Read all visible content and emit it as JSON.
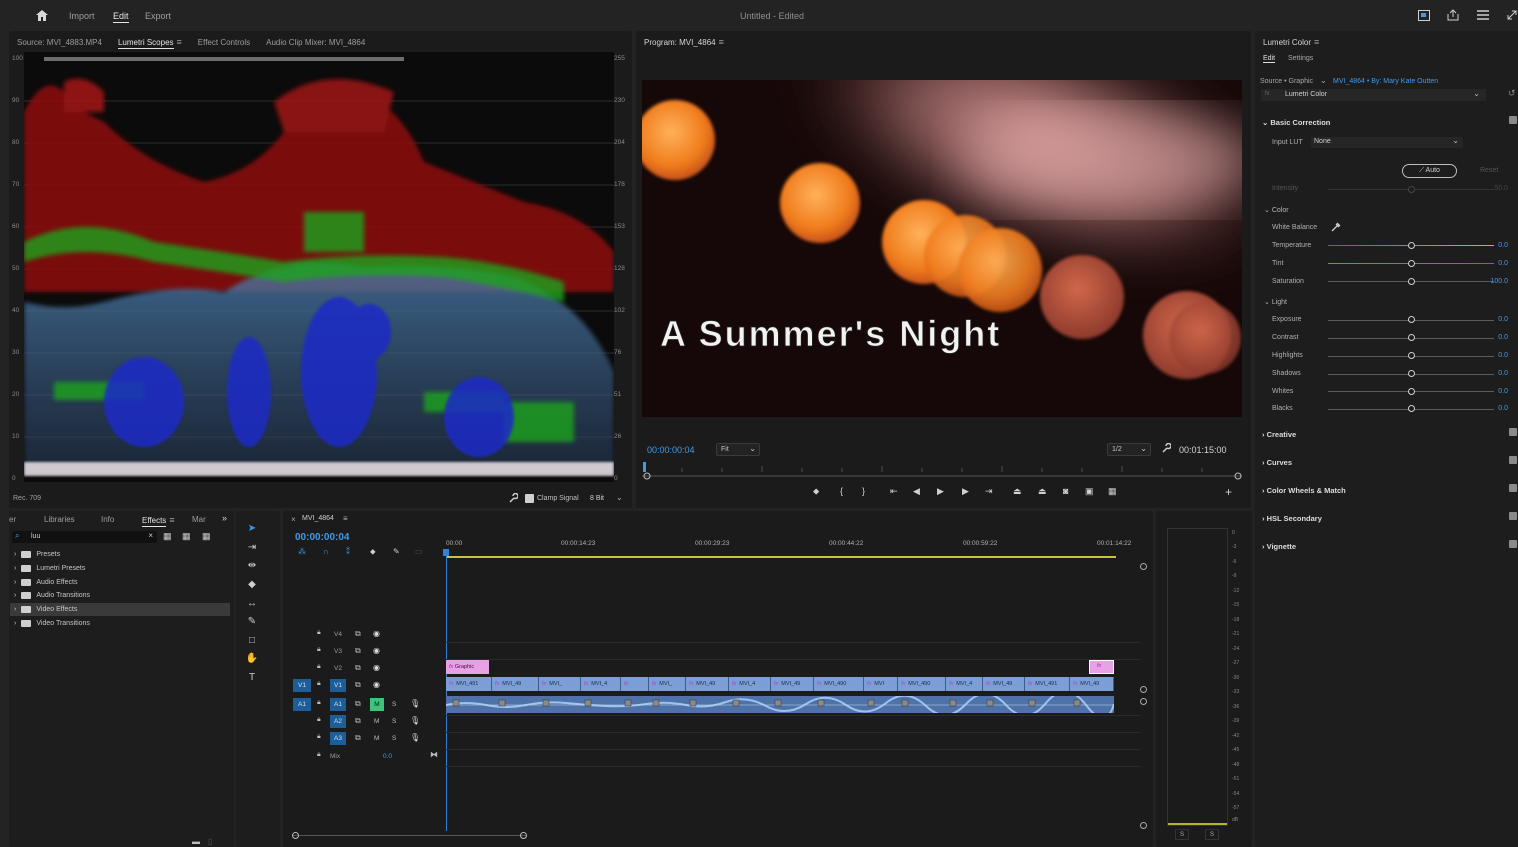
{
  "topbar": {
    "tabs": [
      "Import",
      "Edit",
      "Export"
    ],
    "title": "Untitled",
    "title_status": "- Edited"
  },
  "source_panel": {
    "tabs": [
      "Source: MVI_4883.MP4",
      "Lumetri Scopes",
      "Effect Controls",
      "Audio Clip Mixer: MVI_4864"
    ],
    "active_tab": "Lumetri Scopes",
    "left_scale": [
      "100",
      "90",
      "80",
      "70",
      "60",
      "50",
      "40",
      "30",
      "20",
      "10",
      "0"
    ],
    "right_scale": [
      "255",
      "230",
      "204",
      "178",
      "153",
      "128",
      "102",
      "76",
      "51",
      "26",
      "0"
    ],
    "footer_left": "Rec. 709",
    "clamp_label": "Clamp Signal",
    "bit_depth": "8 Bit"
  },
  "program_panel": {
    "title": "Program: MVI_4864",
    "overlay_title": "A Summer's Night",
    "timecode": "00:00:00:04",
    "fit": "Fit",
    "resolution": "1/2",
    "duration": "00:01:15:00"
  },
  "lumetri": {
    "title": "Lumetri Color",
    "tabs": [
      "Edit",
      "Settings"
    ],
    "source_label": "Source • Graphic",
    "source_clip": "MVI_4864 • By: Mary Kate Outten",
    "effect_select": "Lumetri Color",
    "basic_correction": "Basic Correction",
    "input_lut_label": "Input LUT",
    "input_lut_value": "None",
    "auto_label": "Auto",
    "reset_label": "Reset",
    "intensity_label": "Intensity",
    "intensity_value": "50.0",
    "color_section": "Color",
    "white_balance": "White Balance",
    "color_sliders": [
      {
        "label": "Temperature",
        "value": "0.0"
      },
      {
        "label": "Tint",
        "value": "0.0"
      },
      {
        "label": "Saturation",
        "value": "100.0"
      }
    ],
    "light_section": "Light",
    "light_sliders": [
      {
        "label": "Exposure",
        "value": "0.0"
      },
      {
        "label": "Contrast",
        "value": "0.0"
      },
      {
        "label": "Highlights",
        "value": "0.0"
      },
      {
        "label": "Shadows",
        "value": "0.0"
      },
      {
        "label": "Whites",
        "value": "0.0"
      },
      {
        "label": "Blacks",
        "value": "0.0"
      }
    ],
    "sections": [
      "Creative",
      "Curves",
      "Color Wheels & Match",
      "HSL Secondary",
      "Vignette"
    ]
  },
  "effects_panel": {
    "tabs": [
      "er",
      "Libraries",
      "Info",
      "Effects",
      "Mar"
    ],
    "active_tab": "Effects",
    "search_value": "luu",
    "items": [
      "Presets",
      "Lumetri Presets",
      "Audio Effects",
      "Audio Transitions",
      "Video Effects",
      "Video Transitions"
    ],
    "selected_item": "Video Effects"
  },
  "timeline": {
    "sequence_name": "MVI_4864",
    "timecode": "00:00:00:04",
    "ruler": [
      "00:00",
      "00:00:14:23",
      "00:00:29:23",
      "00:00:44:22",
      "00:00:59:22",
      "00:01:14:22"
    ],
    "video_tracks": [
      "V4",
      "V3",
      "V2",
      "V1"
    ],
    "audio_tracks": [
      "A1",
      "A2",
      "A3"
    ],
    "source_v": "V1",
    "source_a": "A1",
    "mix_label": "Mix",
    "mix_value": "0.0",
    "graphic_clip": "Graphic",
    "v1_clips": [
      "MVI_491",
      "MVI_49",
      "MVI_",
      "MVI_4",
      "MVI_",
      "MVI_49",
      "MVI_4",
      "MVI_49",
      "MVI_490",
      "MVI",
      "MVI_490",
      "MVI_4",
      "MVI_49",
      "MVI_491",
      "MVI_49"
    ]
  },
  "meter": {
    "scale": [
      "0",
      "-3",
      "-6",
      "-9",
      "-12",
      "-15",
      "-18",
      "-21",
      "-24",
      "-27",
      "-30",
      "-33",
      "-36",
      "-39",
      "-42",
      "-45",
      "-48",
      "-51",
      "-54",
      "-57",
      "dB"
    ],
    "solo_labels": [
      "S",
      "S"
    ]
  },
  "colors": {
    "accent_blue": "#3f9bea",
    "playhead_blue": "#2f82d6",
    "clip_video": "#7b9ed6",
    "clip_graphic": "#e7a1e4",
    "audio_clip": "#4f73a8"
  }
}
